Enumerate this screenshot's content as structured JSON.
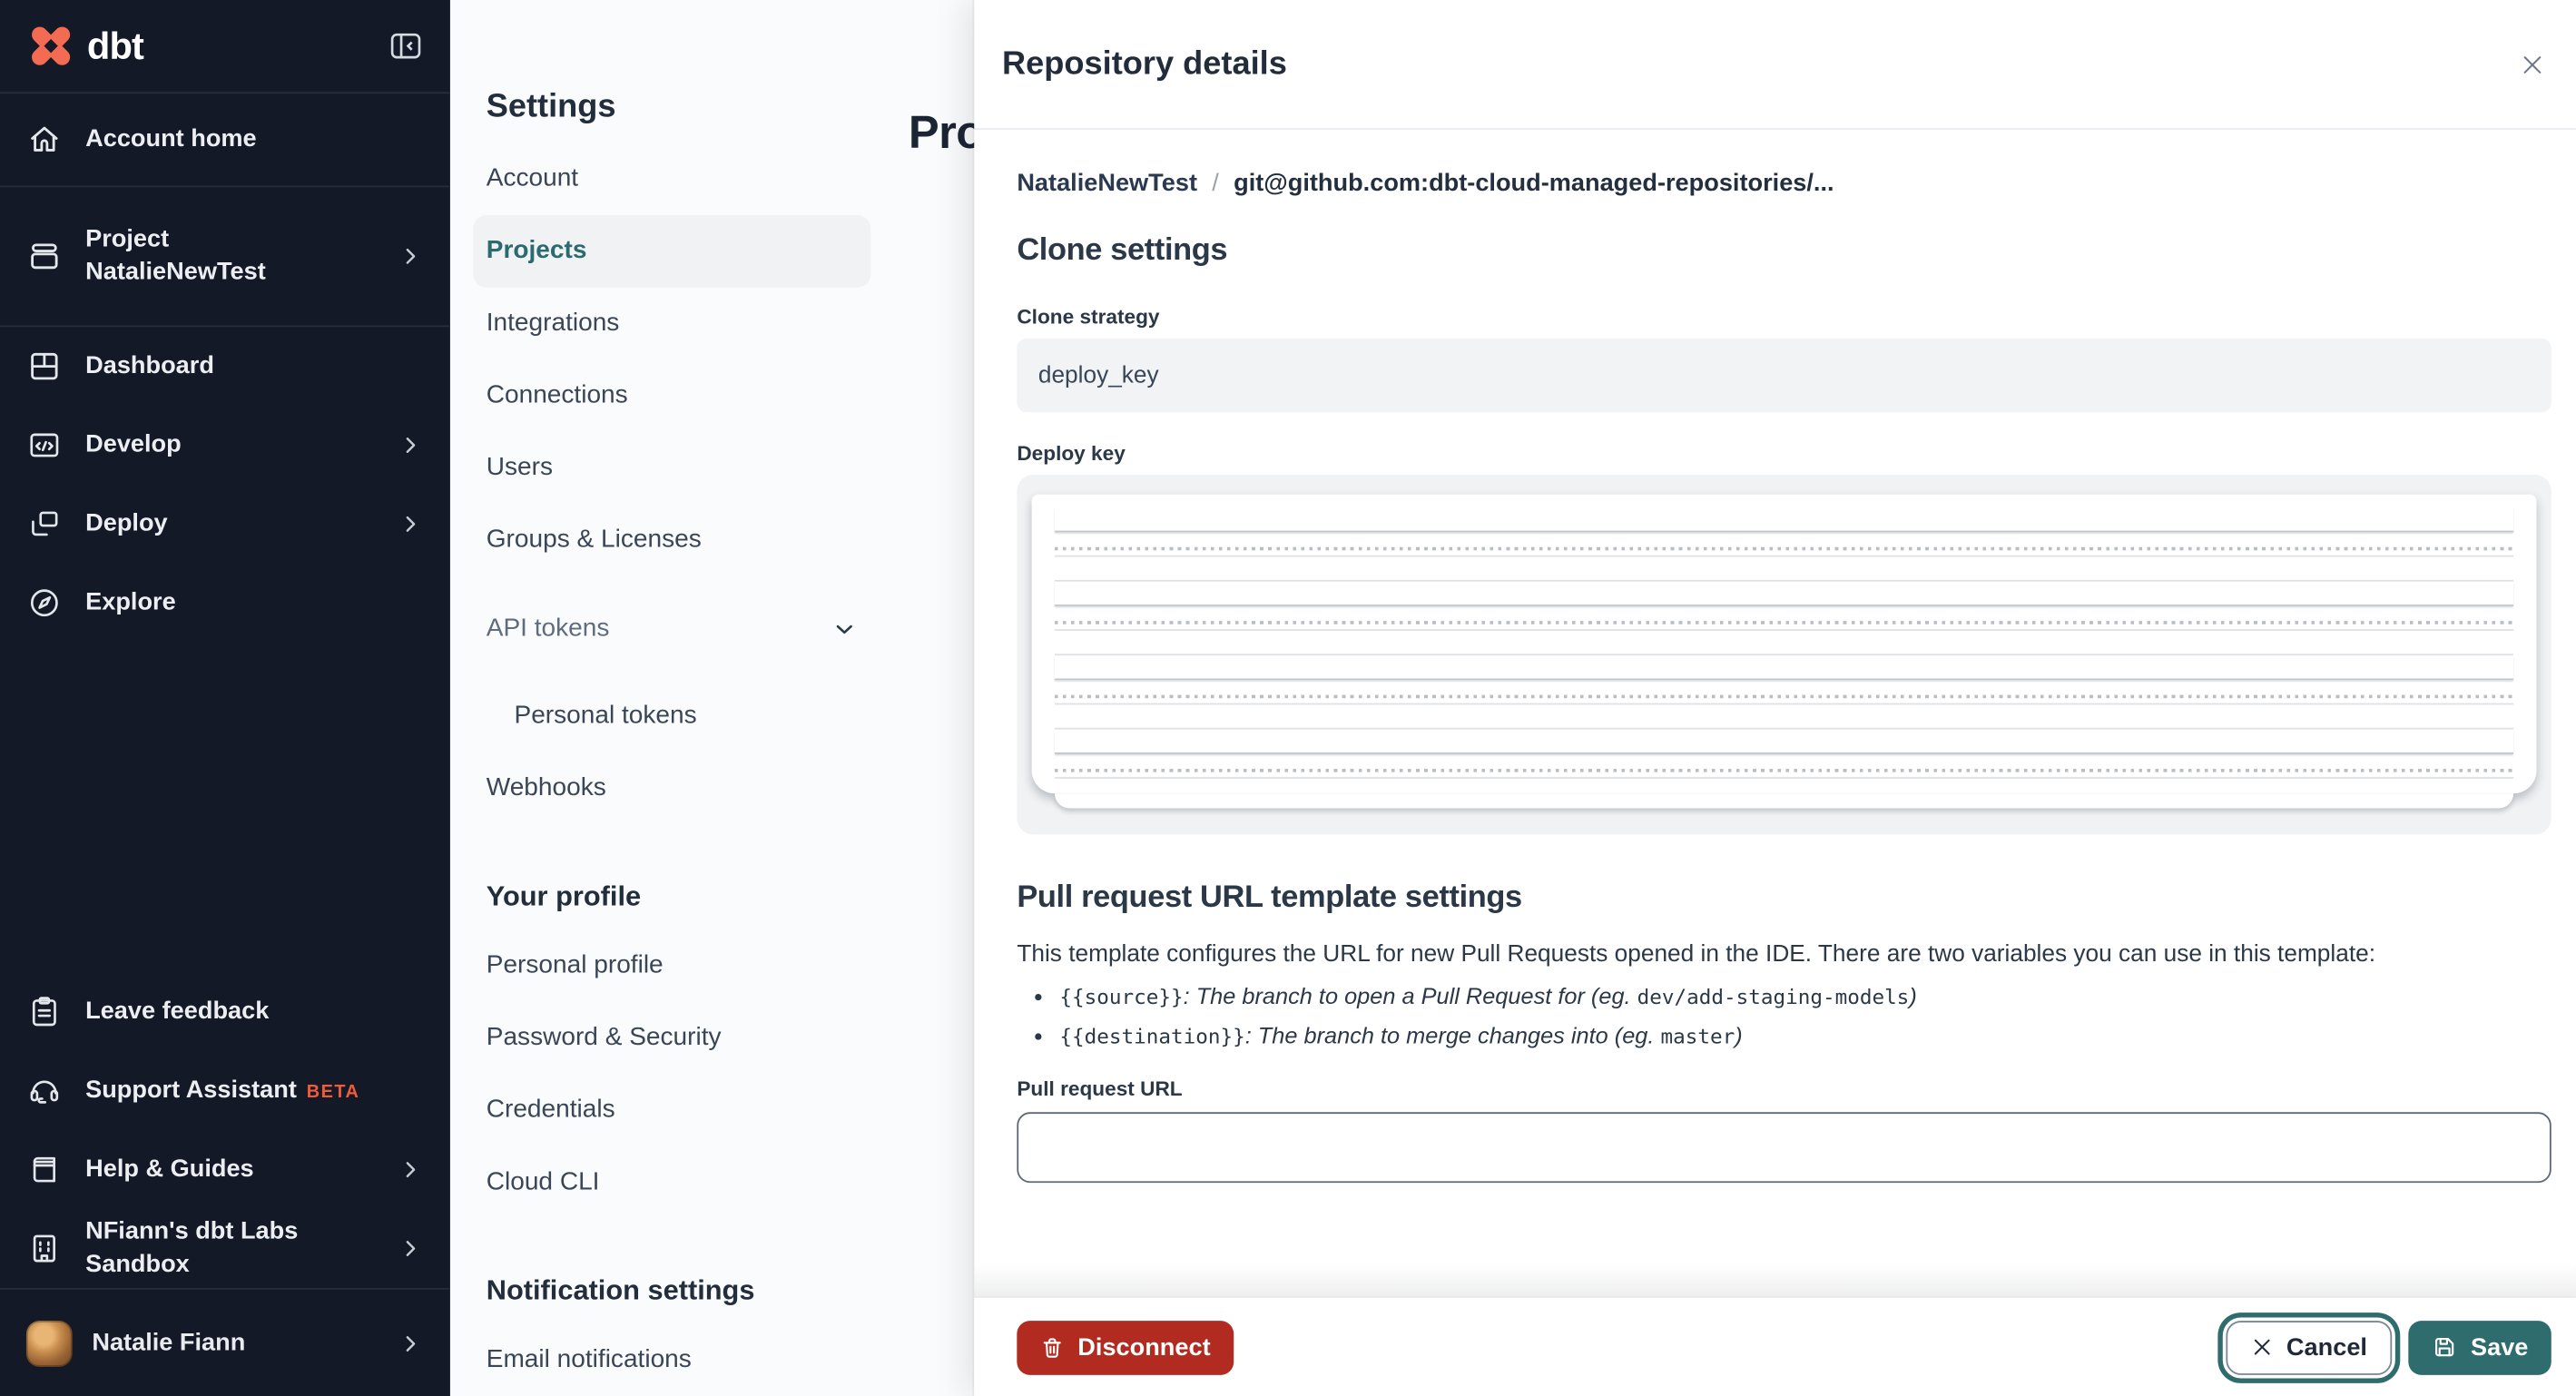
{
  "sidebar": {
    "logo_text": "dbt",
    "items": [
      {
        "label": "Account home"
      },
      {
        "label_top": "Project",
        "label_bottom": "NatalieNewTest"
      },
      {
        "label": "Dashboard"
      },
      {
        "label": "Develop"
      },
      {
        "label": "Deploy"
      },
      {
        "label": "Explore"
      }
    ],
    "bottom_items": [
      {
        "label": "Leave feedback"
      },
      {
        "label": "Support Assistant",
        "badge": "BETA"
      },
      {
        "label": "Help & Guides"
      },
      {
        "label": "NFiann's dbt Labs Sandbox"
      }
    ],
    "user": {
      "name": "Natalie Fiann"
    }
  },
  "settings_nav": {
    "title": "Settings",
    "items": [
      "Account",
      "Projects",
      "Integrations",
      "Connections",
      "Users",
      "Groups & Licenses",
      "API tokens",
      "Personal tokens",
      "Webhooks"
    ],
    "active_item": "Projects",
    "profile_title": "Your profile",
    "profile_items": [
      "Personal profile",
      "Password & Security",
      "Credentials",
      "Cloud CLI"
    ],
    "notification_title": "Notification settings",
    "notification_items": [
      "Email notifications"
    ]
  },
  "page": {
    "title": "Projects"
  },
  "drawer": {
    "title": "Repository details",
    "breadcrumb": {
      "project": "NatalieNewTest",
      "separator": "/",
      "repository": "git@github.com:dbt-cloud-managed-repositories/..."
    },
    "clone_settings": {
      "heading": "Clone settings",
      "clone_strategy_label": "Clone strategy",
      "clone_strategy_value": "deploy_key",
      "deploy_key_label": "Deploy key"
    },
    "pr_template": {
      "heading": "Pull request URL template settings",
      "intro": "This template configures the URL for new Pull Requests opened in the IDE. There are two variables you can use in this template:",
      "bullets": [
        {
          "code": "{{source}}",
          "desc": ": The branch to open a Pull Request for (eg. ",
          "example": "dev/add-staging-models",
          "close": ")"
        },
        {
          "code": "{{destination}}",
          "desc": ": The branch to merge changes into (eg. ",
          "example": "master",
          "close": ")"
        }
      ],
      "pr_url_label": "Pull request URL",
      "pr_url_value": ""
    },
    "footer": {
      "disconnect_label": "Disconnect",
      "cancel_label": "Cancel",
      "save_label": "Save"
    }
  },
  "colors": {
    "sidebar_bg": "#131927",
    "logo_orange": "#f26b52",
    "beta_orange": "#f15b38",
    "accent_teal": "#2e6c6e",
    "nav_active_teal": "#2b6a6e",
    "danger_red": "#b12b21"
  }
}
